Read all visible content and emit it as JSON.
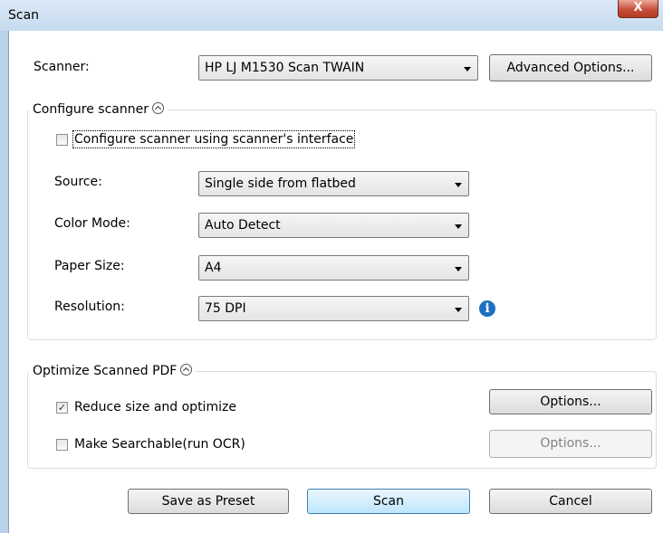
{
  "window": {
    "title": "Scan",
    "close_glyph": "X"
  },
  "scanner": {
    "label": "Scanner:",
    "selected": "HP LJ M1530 Scan TWAIN",
    "advanced_button": "Advanced Options..."
  },
  "configure_group": {
    "title": "Configure scanner",
    "use_interface_label": "Configure scanner using scanner's interface",
    "use_interface_checked": false,
    "source": {
      "label": "Source:",
      "value": "Single side from flatbed"
    },
    "color_mode": {
      "label": "Color Mode:",
      "value": "Auto Detect"
    },
    "paper_size": {
      "label": "Paper Size:",
      "value": "A4"
    },
    "resolution": {
      "label": "Resolution:",
      "value": "75  DPI"
    },
    "info_glyph": "i"
  },
  "optimize_group": {
    "title": "Optimize Scanned PDF",
    "reduce_label": "Reduce size and optimize",
    "reduce_checked": true,
    "reduce_check_glyph": "✓",
    "searchable_label": "Make Searchable(run OCR)",
    "searchable_checked": false,
    "options_button": "Options...",
    "options_button_disabled": "Options..."
  },
  "footer": {
    "save_preset": "Save as Preset",
    "scan": "Scan",
    "cancel": "Cancel"
  }
}
